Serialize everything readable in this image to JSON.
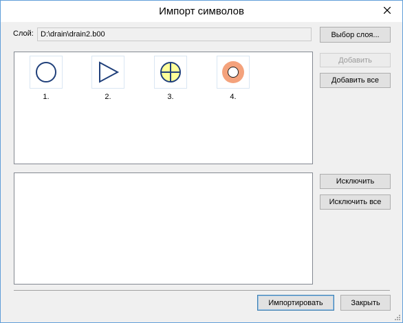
{
  "window": {
    "title": "Импорт символов"
  },
  "layer": {
    "label": "Слой:",
    "path": "D:\\drain\\drain2.b00",
    "select_button": "Выбор слоя..."
  },
  "buttons": {
    "add": "Добавить",
    "add_all": "Добавить все",
    "exclude": "Исключить",
    "exclude_all": "Исключить все",
    "import": "Импортировать",
    "close": "Закрыть"
  },
  "symbols": [
    {
      "label": "1.",
      "icon": "circle-outline-icon",
      "color": "#1f3f7a"
    },
    {
      "label": "2.",
      "icon": "triangle-play-icon",
      "color": "#1f3f7a"
    },
    {
      "label": "3.",
      "icon": "crosshair-circle-icon",
      "color": "#1f3f7a",
      "fill": "#ffff99"
    },
    {
      "label": "4.",
      "icon": "ring-target-icon",
      "color": "#f4a27c"
    }
  ],
  "colors": {
    "accent": "#5f9ed9",
    "disabled_text": "#9a9a9a"
  }
}
